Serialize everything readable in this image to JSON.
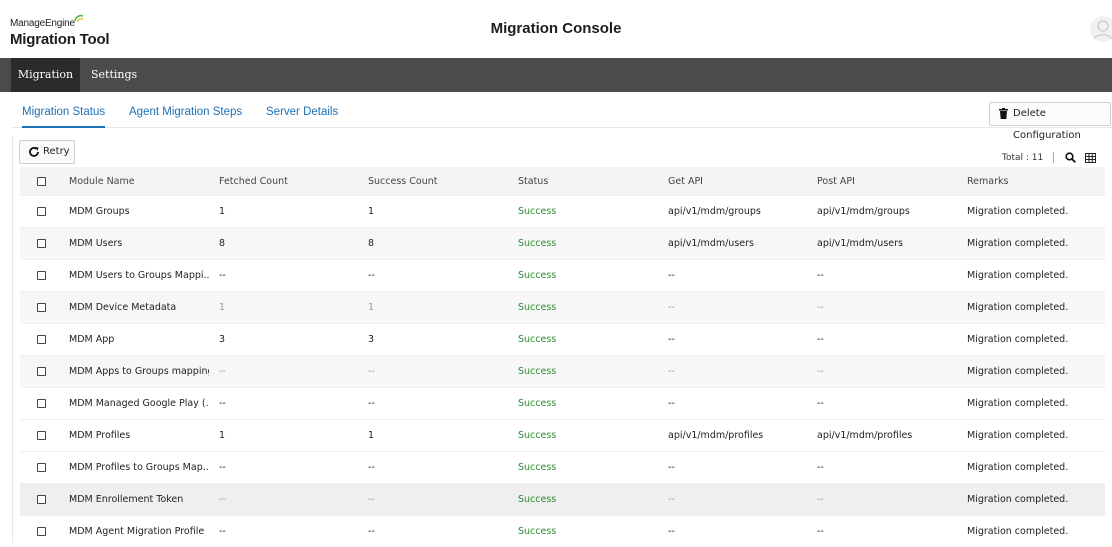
{
  "brand": {
    "top": "ManageEngine",
    "bottom": "Migration Tool",
    "accent": "#5cb85c"
  },
  "page_title": "Migration Console",
  "nav": {
    "items": [
      {
        "label": "Migration",
        "active": true
      },
      {
        "label": "Settings",
        "active": false
      }
    ]
  },
  "tabs": [
    {
      "label": "Migration Status",
      "active": true
    },
    {
      "label": "Agent Migration Steps",
      "active": false
    },
    {
      "label": "Server Details",
      "active": false
    }
  ],
  "toolbar": {
    "delete_label": "Delete Configuration",
    "retry_label": "Retry",
    "total_label": "Total : 11",
    "icons": [
      "trash-icon",
      "refresh-icon",
      "search-icon",
      "columns-icon"
    ]
  },
  "table": {
    "headers": [
      "Module Name",
      "Fetched Count",
      "Success Count",
      "Status",
      "Get API",
      "Post API",
      "Remarks"
    ],
    "rows": [
      [
        "MDM Groups",
        "1",
        "1",
        "Success",
        "api/v1/mdm/groups",
        "api/v1/mdm/groups",
        "Migration completed."
      ],
      [
        "MDM Users",
        "8",
        "8",
        "Success",
        "api/v1/mdm/users",
        "api/v1/mdm/users",
        "Migration completed."
      ],
      [
        "MDM Users to Groups Mappi...",
        "--",
        "--",
        "Success",
        "--",
        "--",
        "Migration completed."
      ],
      [
        "MDM Device Metadata",
        "1",
        "1",
        "Success",
        "--",
        "--",
        "Migration completed."
      ],
      [
        "MDM App",
        "3",
        "3",
        "Success",
        "--",
        "--",
        "Migration completed."
      ],
      [
        "MDM Apps to Groups mapping",
        "--",
        "--",
        "Success",
        "--",
        "--",
        "Migration completed."
      ],
      [
        "MDM Managed Google Play (...",
        "--",
        "--",
        "Success",
        "--",
        "--",
        "Migration completed."
      ],
      [
        "MDM Profiles",
        "1",
        "1",
        "Success",
        "api/v1/mdm/profiles",
        "api/v1/mdm/profiles",
        "Migration completed."
      ],
      [
        "MDM Profiles to Groups Map...",
        "--",
        "--",
        "Success",
        "--",
        "--",
        "Migration completed."
      ],
      [
        "MDM Enrollement Token",
        "--",
        "--",
        "Success",
        "--",
        "--",
        "Migration completed."
      ],
      [
        "MDM Agent Migration Profile",
        "--",
        "--",
        "Success",
        "--",
        "--",
        "Migration completed."
      ]
    ]
  },
  "colors": {
    "link": "#1f6fb4",
    "success": "#2e8b2e",
    "nav_bg": "#4b4b4b",
    "nav_active": "#2b2b2b"
  }
}
